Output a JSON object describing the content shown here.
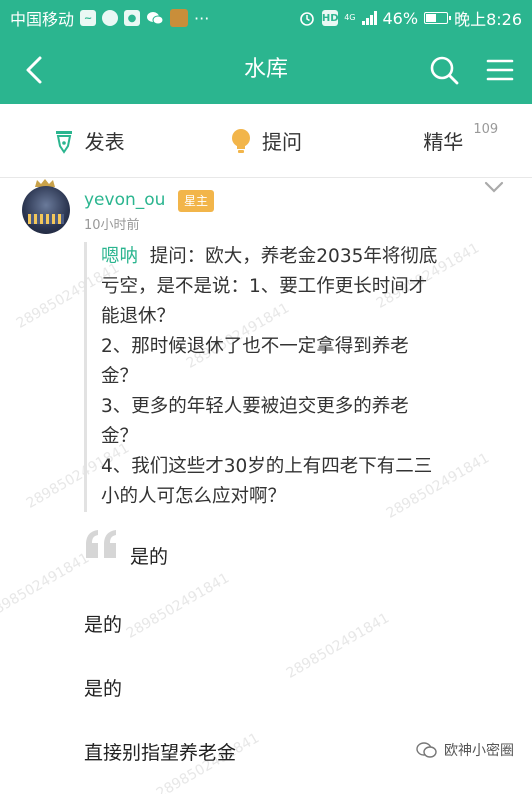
{
  "status_bar": {
    "carrier": "中国移动",
    "battery": "46%",
    "battery_level": 0.46,
    "time": "晚上8:26",
    "more": "···",
    "network": "4G"
  },
  "nav": {
    "title": "水库"
  },
  "tabs": [
    {
      "label": "发表",
      "icon": "pen-icon"
    },
    {
      "label": "提问",
      "icon": "lightbulb-icon"
    },
    {
      "label": "精华",
      "count": "109"
    }
  ],
  "post": {
    "author": "yevon_ou",
    "badge": "星主",
    "time": "10小时前",
    "quote": {
      "author": "嗯呐",
      "lines": [
        "提问：欧大，养老金2035年将彻底",
        "亏空，是不是说：1、要工作更长时间才",
        "能退休？",
        "2、那时候退休了也不一定拿得到养老",
        "金？",
        "3、更多的年轻人要被迫交更多的养老",
        "金？",
        "4、我们这些才30岁的上有四老下有二三",
        "小的人可怎么应对啊？"
      ]
    },
    "replies": [
      "是的",
      "是的",
      "是的",
      "直接别指望养老金"
    ]
  },
  "watermark_text": "2898502491841",
  "footer_brand": "欧神小密圈",
  "colors": {
    "brand": "#2bb58f",
    "badge": "#f2b54a",
    "lightbulb": "#f2b54a"
  }
}
